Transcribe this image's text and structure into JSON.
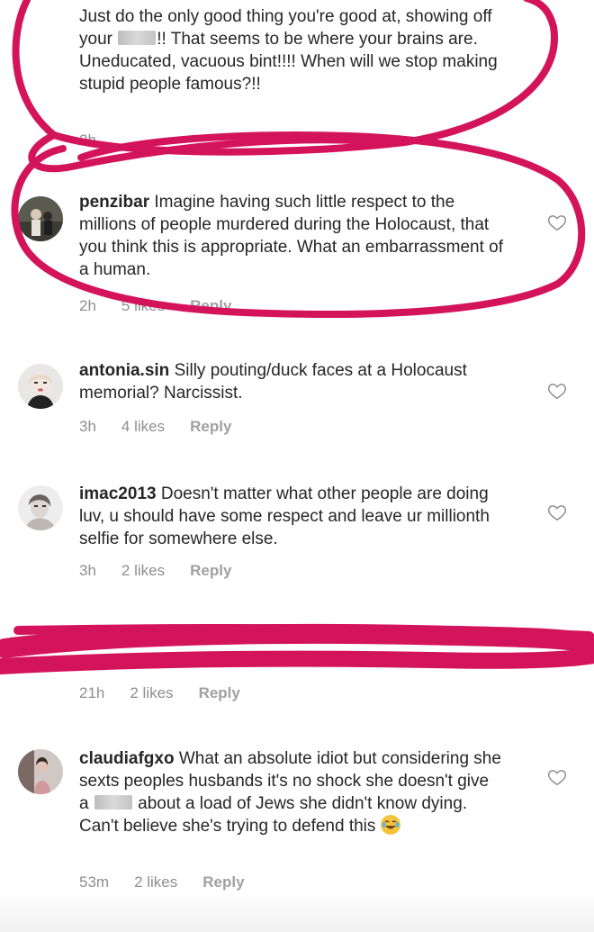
{
  "comments": [
    {
      "text_pre": "Just do the only good thing you're good at, showing off your",
      "text_post": "!! That seems to be where your brains are. Uneducated, vacuous bint!!!! When will we stop making stupid people famous?!!",
      "time": "2h"
    },
    {
      "username": "penzibar",
      "text": "Imagine having such little respect to the millions of people murdered during the Holocaust, that you think this is appropriate. What an embarrassment of a human.",
      "time": "2h",
      "likes": "5 likes",
      "reply": "Reply"
    },
    {
      "username": "antonia.sin",
      "text": "Silly pouting/duck faces at a Holocaust memorial? Narcissist.",
      "time": "3h",
      "likes": "4 likes",
      "reply": "Reply"
    },
    {
      "username": "imac2013",
      "text": "Doesn't matter what other people are doing luv, u should have some respect and leave ur millionth selfie for somewhere else.",
      "time": "3h",
      "likes": "2 likes",
      "reply": "Reply"
    },
    {
      "time": "21h",
      "likes": "2 likes",
      "reply": "Reply"
    },
    {
      "username": "claudiafgxo",
      "text_pre": "What an absolute idiot but considering she sexts peoples husbands it's no shock she doesn't give a",
      "text_post": "about a load of Jews she didn't know dying. Can't believe she's trying to defend this",
      "time": "53m",
      "likes": "2 likes",
      "reply": "Reply"
    }
  ],
  "colors": {
    "annotation": "#d4145a",
    "text": "#262626",
    "meta": "#8e8e8e"
  },
  "icons": {
    "like": "heart-outline-icon",
    "reaction": "tears-of-joy-emoji-icon"
  }
}
